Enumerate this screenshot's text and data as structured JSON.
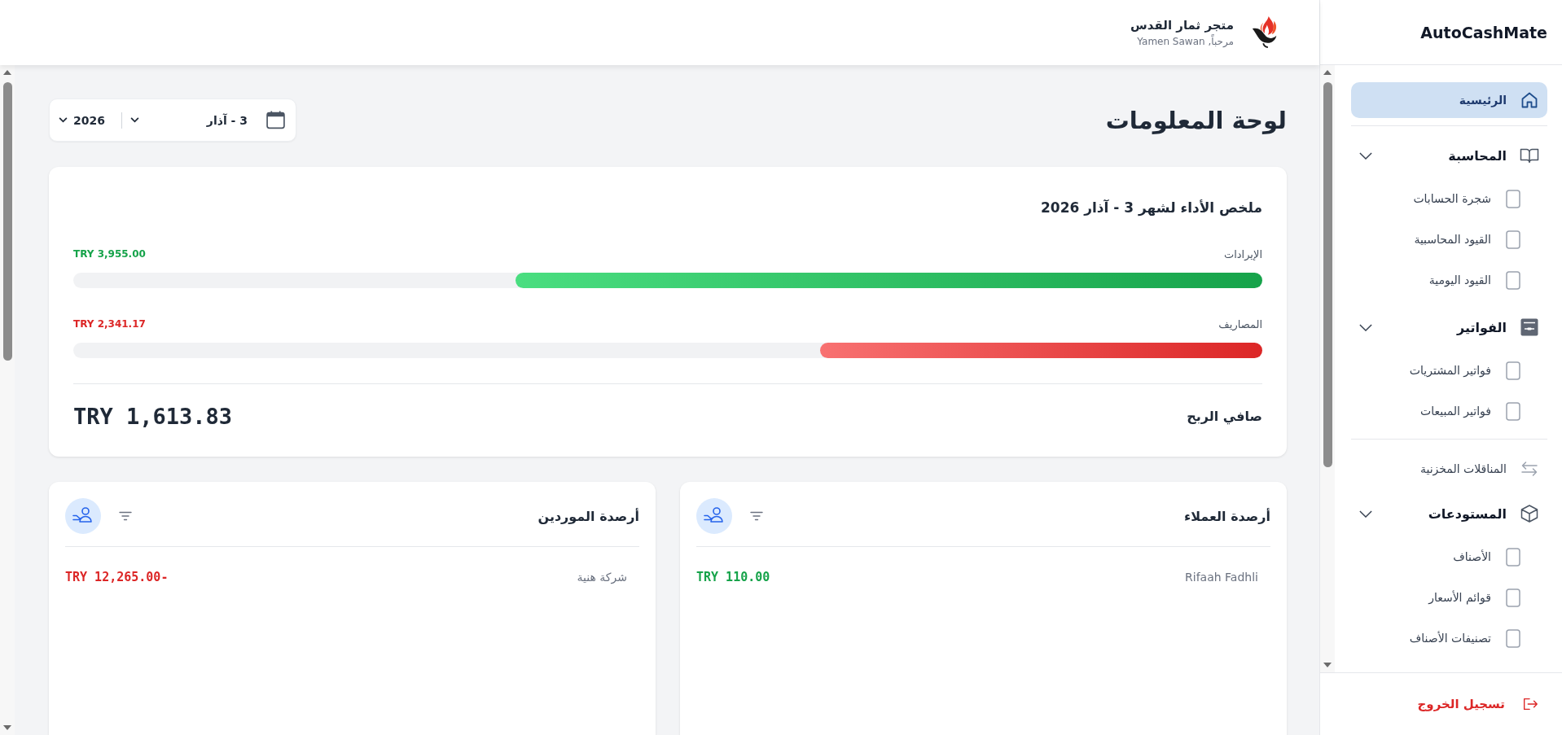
{
  "sidebar": {
    "brand": "AutoCashMate",
    "sections": [
      {
        "items": [
          {
            "kind": "link",
            "label": "الرئيسية",
            "selected": true
          }
        ]
      },
      {
        "items": [
          {
            "kind": "group",
            "label": "المحاسبة",
            "selected": false,
            "expanded": true,
            "children": [
              {
                "label": "شجرة الحسابات",
                "selected": false
              },
              {
                "label": "القيود المحاسبية",
                "selected": false
              },
              {
                "label": "القيود اليومية",
                "selected": false
              }
            ]
          },
          {
            "kind": "group",
            "label": "الفواتير",
            "selected": false,
            "expanded": true,
            "children": [
              {
                "label": "فواتير المشتريات",
                "selected": false
              },
              {
                "label": "فواتير المبيعات",
                "selected": false
              }
            ]
          }
        ]
      },
      {
        "items": [
          {
            "kind": "link",
            "label": "المناقلات المخزنية",
            "selected": false
          },
          {
            "kind": "group",
            "label": "المستودعات",
            "selected": false,
            "expanded": true,
            "children": [
              {
                "label": "الأصناف",
                "selected": false
              },
              {
                "label": "قوائم الأسعار",
                "selected": false
              },
              {
                "label": "تصنيفات الأصناف",
                "selected": false
              }
            ]
          }
        ]
      }
    ],
    "logout": "تسجيل الخروج"
  },
  "header": {
    "store_name": "متجر ثمار القدس",
    "greeting": "مرحباً, Yamen Sawan"
  },
  "dashboard": {
    "title": "لوحة المعلومات",
    "period_picker": {
      "month": "3 - آذار",
      "year": "2026"
    },
    "performance": {
      "title": "ملخص الأداء لشهر 3 - آذار 2026",
      "metrics": [
        {
          "kind": "income",
          "label": "الإيرادات",
          "amount": "TRY 3,955.00",
          "level": 0.628
        },
        {
          "kind": "expense",
          "label": "المصاريف",
          "amount": "TRY 2,341.17",
          "level": 0.372
        }
      ],
      "net_profit": {
        "label": "صافي الربح",
        "amount": "TRY 1,613.83"
      }
    },
    "balances": [
      {
        "title": "أرصدة العملاء",
        "rows": [
          {
            "name": "Rifaah Fadhli",
            "amount": "TRY 110.00",
            "kind": "positive"
          }
        ]
      },
      {
        "title": "أرصدة الموردين",
        "rows": [
          {
            "name": "شركة هنية",
            "amount": "TRY 12,265.00-",
            "kind": "negative"
          }
        ]
      }
    ]
  }
}
